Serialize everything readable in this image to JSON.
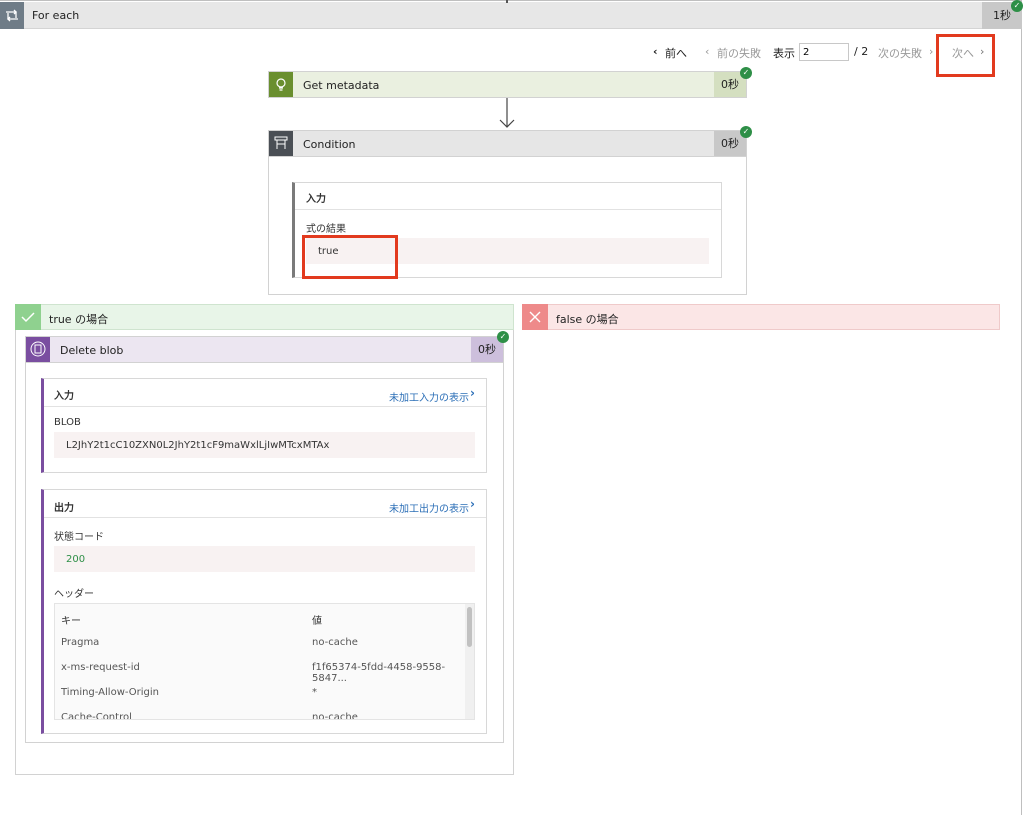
{
  "loop": {
    "title": "For each",
    "duration": "1秒"
  },
  "pager": {
    "prev": "前へ",
    "prev_fail": "前の失敗",
    "show": "表示",
    "page_value": "2",
    "total": "/ 2",
    "next_fail": "次の失敗",
    "next": "次へ"
  },
  "metadata": {
    "title": "Get metadata",
    "duration": "0秒"
  },
  "condition": {
    "title": "Condition",
    "duration": "0秒",
    "input_label": "入力",
    "expr_label": "式の結果",
    "expr_value": "true"
  },
  "true_branch": {
    "title": "true の場合"
  },
  "false_branch": {
    "title": "false の場合"
  },
  "delete_blob": {
    "title": "Delete blob",
    "duration": "0秒",
    "input_label": "入力",
    "raw_input_link": "未加工入力の表示",
    "blob_label": "BLOB",
    "blob_value": "L2JhY2t1cC10ZXN0L2JhY2t1cF9maWxlLjIwMTcxMTAx",
    "output_label": "出力",
    "raw_output_link": "未加工出力の表示",
    "status_label": "状態コード",
    "status_value": "200",
    "headers_label": "ヘッダー",
    "headers": {
      "col_key": "キー",
      "col_val": "値",
      "rows": [
        {
          "k": "Pragma",
          "v": "no-cache"
        },
        {
          "k": "x-ms-request-id",
          "v": "f1f65374-5fdd-4458-9558-5847..."
        },
        {
          "k": "Timing-Allow-Origin",
          "v": "*"
        },
        {
          "k": "Cache-Control",
          "v": "no-cache"
        }
      ]
    }
  },
  "colors": {
    "metadata": "#6a8f2f",
    "condition": "#4a4f55",
    "delete": "#7a4ea0",
    "true_bg": "#e8f5e8",
    "false_bg": "#fbe6e6",
    "success": "#2e8f47",
    "highlight": "#e23a1e"
  }
}
